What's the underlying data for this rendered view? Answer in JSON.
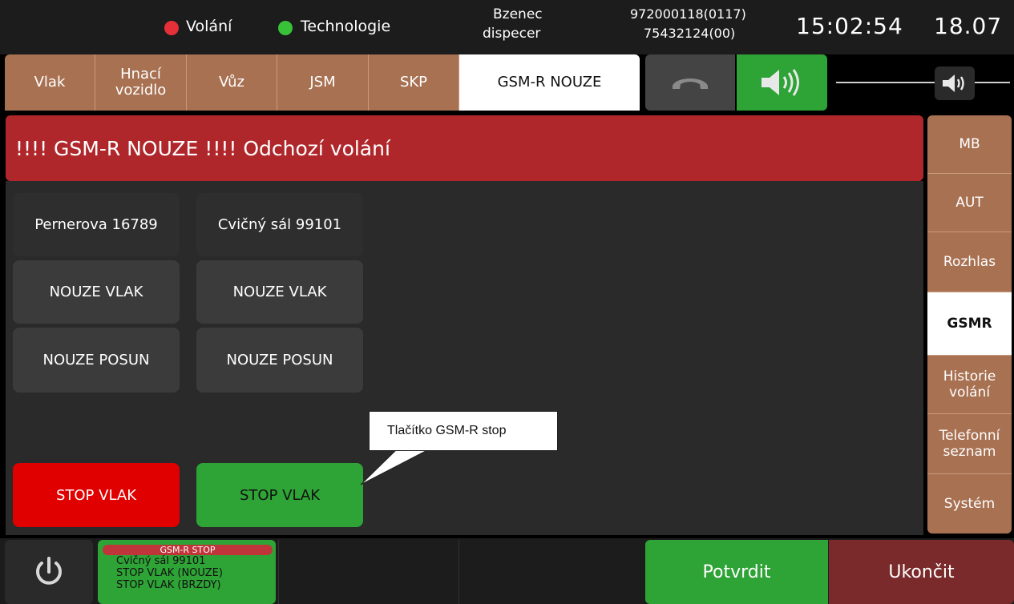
{
  "status": {
    "indicators": [
      {
        "label": "Volání",
        "color": "#e5303a"
      },
      {
        "label": "Technologie",
        "color": "#38c238"
      }
    ],
    "station_line1": "Bzenec",
    "station_line2": "dispecer",
    "number_line1": "972000118(0117)",
    "number_line2": "75432124(00)",
    "time": "15:02:54",
    "date": "18.07"
  },
  "top_tabs": [
    {
      "label": "Vlak"
    },
    {
      "label": "Hnací\nvozidlo"
    },
    {
      "label": "Vůz"
    },
    {
      "label": "JSM"
    },
    {
      "label": "SKP"
    },
    {
      "label": "GSM-R NOUZE",
      "active": true
    }
  ],
  "controls": {
    "hangup_icon": "handset-icon",
    "speaker_icon": "speaker-icon",
    "volume_icon": "volume-knob-icon",
    "volume_level": 1.0
  },
  "banner": "!!!! GSM-R NOUZE !!!! Odchozí volání",
  "columns": [
    {
      "name": "Pernerova 16789",
      "buttons": [
        "NOUZE VLAK",
        "NOUZE POSUN"
      ],
      "stop": "STOP VLAK",
      "stop_color": "#e00000"
    },
    {
      "name": "Cvičný sál 99101",
      "buttons": [
        "NOUZE VLAK",
        "NOUZE POSUN"
      ],
      "stop": "STOP VLAK",
      "stop_color": "#2ea336"
    }
  ],
  "side_menu": [
    {
      "label": "MB"
    },
    {
      "label": "AUT"
    },
    {
      "label": "Rozhlas"
    },
    {
      "label": "GSMR",
      "active": true
    },
    {
      "label": "Historie\nvolání"
    },
    {
      "label": "Telefonní\nseznam"
    },
    {
      "label": "Systém"
    }
  ],
  "bottom": {
    "power_icon": "power-icon",
    "stop_title": "GSM-R STOP",
    "stop_lines": [
      "Cvičný sál 99101",
      "STOP VLAK (NOUZE)",
      "STOP VLAK (BRZDY)"
    ],
    "confirm": "Potvrdit",
    "end": "Ukončit"
  },
  "callout": "Tlačítko GSM-R stop"
}
